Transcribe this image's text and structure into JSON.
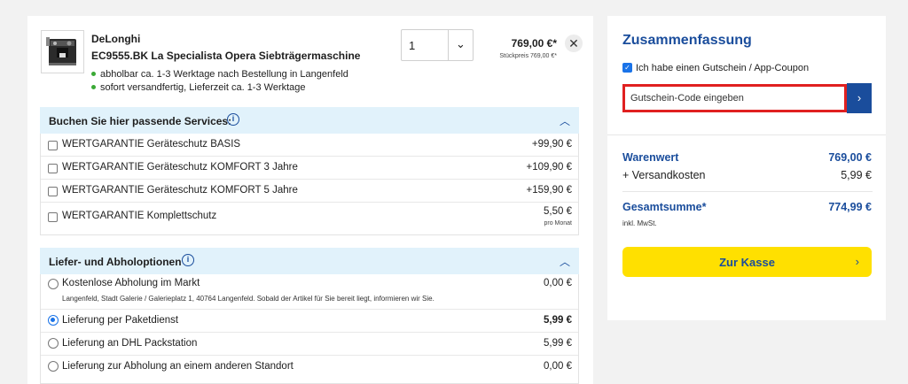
{
  "product": {
    "brand": "DeLonghi",
    "name": "EC9555.BK La Specialista Opera Siebträgermaschine",
    "availability": [
      "abholbar ca. 1-3 Werktage nach Bestellung in Langenfeld",
      "sofort versandfertig, Lieferzeit ca. 1-3 Werktage"
    ],
    "quantity": "1",
    "price": "769,00 €*",
    "unit_price": "Stückpreis 769,00 €*",
    "image_icon": "coffee-machine-icon",
    "status_color": "#3aa935"
  },
  "services": {
    "title": "Buchen Sie hier passende Services:",
    "items": [
      {
        "label": "WERTGARANTIE Geräteschutz BASIS",
        "price": "+99,90 €"
      },
      {
        "label": "WERTGARANTIE Geräteschutz KOMFORT 3 Jahre",
        "price": "+109,90 €"
      },
      {
        "label": "WERTGARANTIE Geräteschutz KOMFORT 5 Jahre",
        "price": "+159,90 €"
      },
      {
        "label": "WERTGARANTIE Komplettschutz",
        "price": "5,50 €",
        "sub": "pro Monat"
      }
    ]
  },
  "delivery": {
    "title": "Liefer- und Abholoptionen",
    "options": [
      {
        "label": "Kostenlose Abholung im Markt",
        "price": "0,00 €",
        "desc": "Langenfeld, Stadt Galerie / Galerieplatz 1, 40764 Langenfeld. Sobald der Artikel für Sie bereit liegt, informieren wir Sie.",
        "selected": false
      },
      {
        "label": "Lieferung per Paketdienst",
        "price": "5,99 €",
        "selected": true
      },
      {
        "label": "Lieferung an DHL Packstation",
        "price": "5,99 €",
        "selected": false
      },
      {
        "label": "Lieferung zur Abholung an einem anderen Standort",
        "price": "0,00 €",
        "selected": false
      }
    ]
  },
  "summary": {
    "title": "Zusammenfassung",
    "coupon_checkbox_label": "Ich habe einen Gutschein / App-Coupon",
    "coupon_checked": true,
    "coupon_placeholder": "Gutschein-Code eingeben",
    "warenwert_label": "Warenwert",
    "warenwert": "769,00 €",
    "versand_label": "+ Versandkosten",
    "versand": "5,99 €",
    "total_label": "Gesamtsumme*",
    "total": "774,99 €",
    "tax_note": "inkl. MwSt.",
    "checkout_label": "Zur Kasse"
  },
  "colors": {
    "accent_blue": "#1a4d9c",
    "checkout_yellow": "#ffe000",
    "highlight_red": "#e02020",
    "section_bg": "#e1f2fb"
  }
}
